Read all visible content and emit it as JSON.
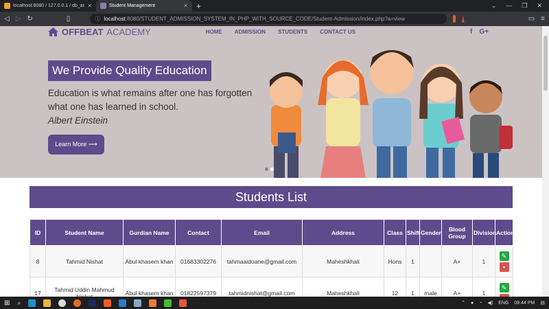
{
  "browser": {
    "tabs": [
      {
        "title": "localhost:8080 / 127.0.0.1 / db_admissi",
        "active": false
      },
      {
        "title": "Student Management",
        "active": true
      }
    ],
    "new_tab": "+",
    "url_host": "localhost",
    "url_rest": ":8080/STUDENT_ADMISSION_SYSTEM_IN_PHP_WITH_SOURCE_CODE/Student-Admission/index.php?a=view"
  },
  "nav": {
    "brand_bold": "OFFBEAT",
    "brand_light": "ACADEMY",
    "links": [
      "HOME",
      "ADMISSION",
      "STUDENTS",
      "CONTACT US"
    ],
    "social": [
      "f",
      "G+"
    ]
  },
  "hero": {
    "headline": "We Provide Quality Education",
    "quote": "Education is what remains after one has forgotten what one has learned in school.",
    "author": "Albert Einstein",
    "button": "Learn More ⟶"
  },
  "list_title": "Students List",
  "table": {
    "headers": [
      "ID",
      "Student Name",
      "Gurdian Name",
      "Contact",
      "Email",
      "Address",
      "Class",
      "Shift",
      "Gender",
      "Blood Group",
      "Division",
      "Action"
    ],
    "rows": [
      [
        "8",
        "Tahmid Nishat",
        "Abul khasem khan",
        "01683302276",
        "tahmaaidoane@gmail.com",
        "Maheshkhali",
        "Hons",
        "1",
        "",
        "A+",
        "1"
      ],
      [
        "17",
        "Tahmid Uddin Mahmud Nishat",
        "Abul khasem khan",
        "01822597379",
        "tahmidnishat@gmail.com",
        "Maheshkhali",
        "12",
        "1",
        "male",
        "A+",
        "1"
      ]
    ]
  },
  "taskbar": {
    "lang": "ENG",
    "time": "08:44 PM"
  },
  "colors": {
    "brand": "#5e4b8b",
    "hero_bg": "#cbc3c3",
    "edit": "#28a745",
    "delete": "#d9534f"
  }
}
